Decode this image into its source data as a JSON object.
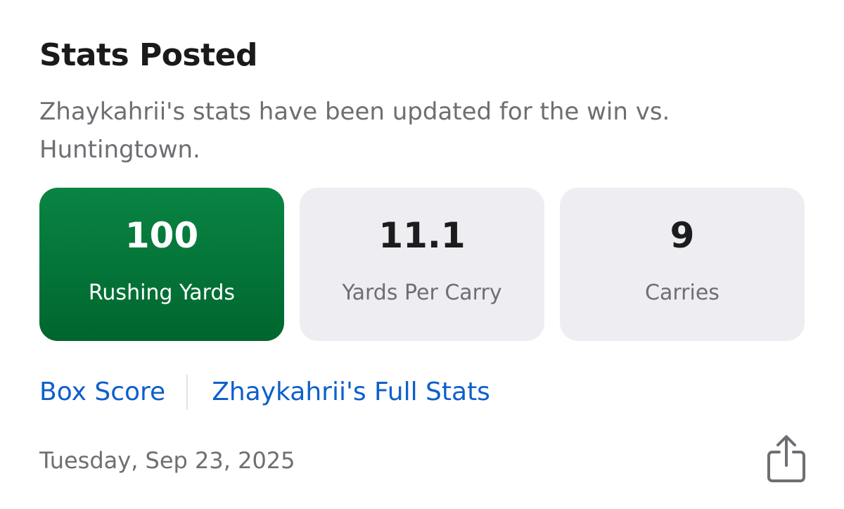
{
  "header": {
    "title": "Stats Posted",
    "subtitle": "Zhaykahrii's stats have been updated for the win vs. Huntingtown."
  },
  "stats": [
    {
      "value": "100",
      "label": "Rushing Yards"
    },
    {
      "value": "11.1",
      "label": "Yards Per Carry"
    },
    {
      "value": "9",
      "label": "Carries"
    }
  ],
  "links": {
    "box_score": "Box Score",
    "full_stats": "Zhaykahrii's Full Stats"
  },
  "footer": {
    "date": "Tuesday, Sep 23, 2025",
    "share_icon": "share-icon"
  },
  "colors": {
    "highlight_card": "#0a7a3c",
    "link": "#0d5fcc",
    "secondary_text": "#6e6e73",
    "card_background": "#eeeef2"
  }
}
